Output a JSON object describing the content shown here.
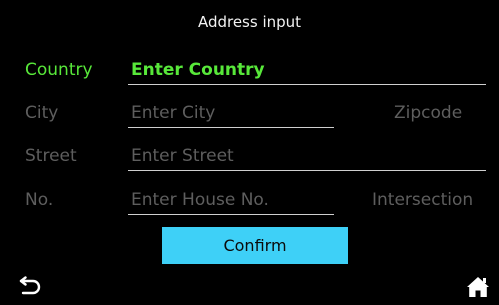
{
  "header": {
    "title": "Address input"
  },
  "form": {
    "country": {
      "label": "Country",
      "placeholder": "Enter Country"
    },
    "city": {
      "label": "City",
      "placeholder": "Enter City",
      "side_button": "Zipcode"
    },
    "street": {
      "label": "Street",
      "placeholder": "Enter Street"
    },
    "number": {
      "label": "No.",
      "placeholder": "Enter House No.",
      "side_button": "Intersection"
    }
  },
  "confirm_label": "Confirm",
  "nav": {
    "back_icon": "back-arrow-icon",
    "home_icon": "home-icon"
  },
  "colors": {
    "active": "#58e83a",
    "inactive": "#5e5e5e",
    "button": "#3ed0f7",
    "background": "#000000"
  }
}
